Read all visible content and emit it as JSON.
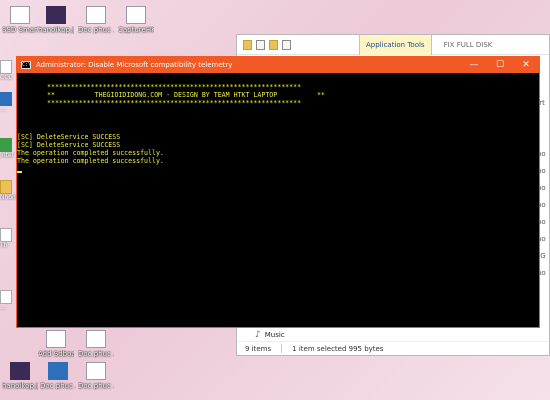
{
  "desktop": {
    "top_icons": [
      {
        "label": "SSD Smart Grabber",
        "style": "light"
      },
      {
        "label": "hanoikop.jpg",
        "style": "dark"
      },
      {
        "label": "Doc phuc ...",
        "style": "light"
      },
      {
        "label": "CaptureHKS",
        "style": "light"
      }
    ],
    "left_icons": [
      {
        "label": "CCC",
        "style": "light"
      },
      {
        "label": "...",
        "style": "blue"
      },
      {
        "label": "Intel",
        "style": "green"
      },
      {
        "label": "Nhom",
        "style": "folder"
      },
      {
        "label": "Th",
        "style": "light"
      },
      {
        "label": "...",
        "style": "light"
      }
    ],
    "mid_icons": [
      {
        "label": "Add Sdboard...",
        "style": "light"
      },
      {
        "label": "Doc phuc ...",
        "style": "light"
      }
    ],
    "bottom_icons": [
      {
        "label": "hanoikop.jpg",
        "style": "dark"
      },
      {
        "label": "Doc phuc ...",
        "style": "blue"
      },
      {
        "label": "Doc phuc ...",
        "style": "light"
      }
    ]
  },
  "explorer": {
    "ribbon_context_tab": "Application Tools",
    "title": "FIX FULL DISK",
    "music_label": "Music",
    "status_items": "9 items",
    "status_selected": "1 item selected  995 bytes",
    "right_fragments": [
      "ert",
      "",
      "",
      "ino",
      "ino",
      "ino",
      "ino",
      "ino",
      "ino",
      "NG",
      "ino"
    ]
  },
  "console": {
    "title": "Administrator:  Disable Microsoft compatibility telemetry",
    "banner_border": "****************************************************************",
    "banner_text": "**          THEGIOIDIDONG.COM - DESIGN BY TEAM HTKT LAPTOP          **",
    "lines": [
      "[SC] DeleteService SUCCESS",
      "[SC] DeleteService SUCCESS",
      "The operation completed successfully.",
      "The operation completed successfully."
    ],
    "minimize_glyph": "—",
    "maximize_glyph": "☐",
    "close_glyph": "✕",
    "icon_glyph": "C:\\"
  },
  "colors": {
    "console_accent": "#f15a24",
    "console_text": "#f1ee3e",
    "ribbon_context": "#fff4c4"
  }
}
